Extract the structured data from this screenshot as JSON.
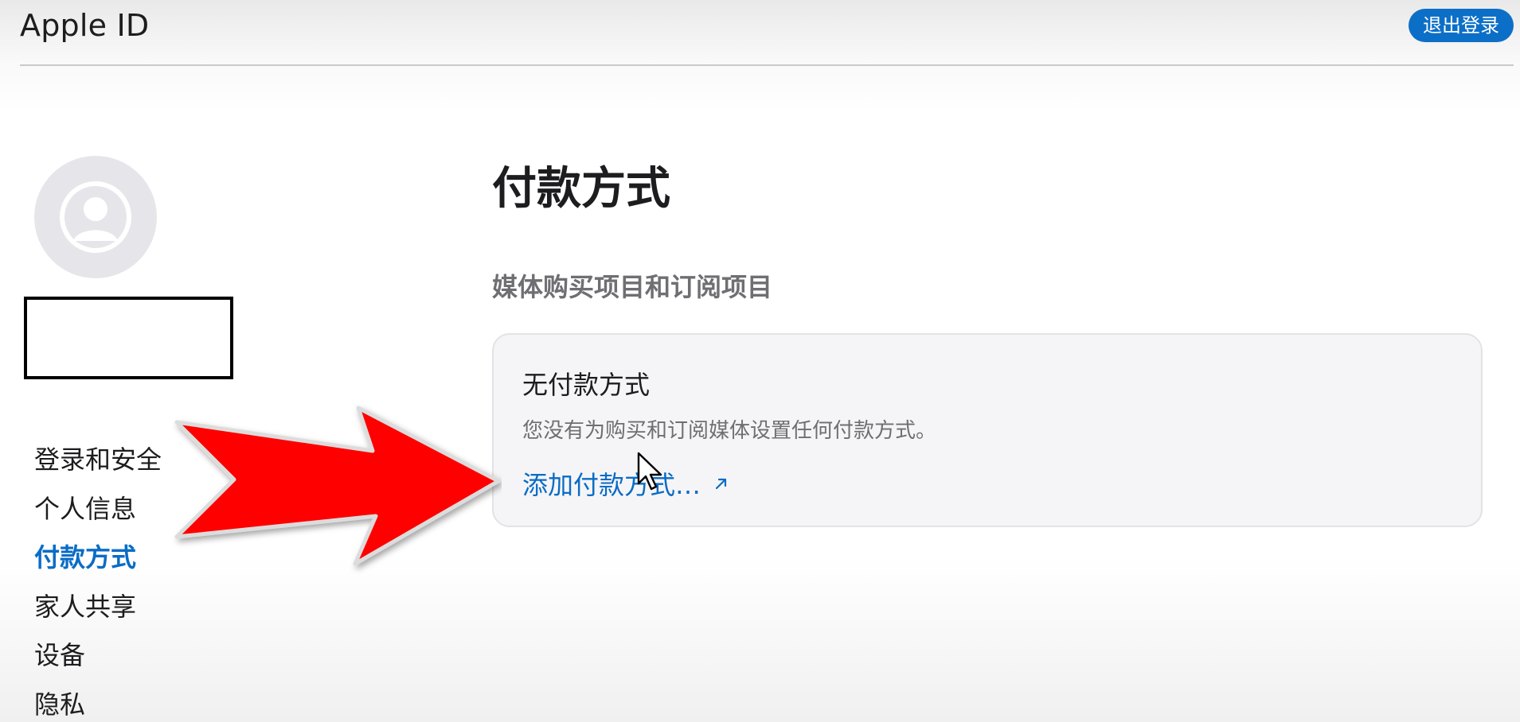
{
  "header": {
    "title": "Apple ID",
    "signout_label": "退出登录"
  },
  "sidebar": {
    "items": [
      {
        "label": "登录和安全",
        "active": false
      },
      {
        "label": "个人信息",
        "active": false
      },
      {
        "label": "付款方式",
        "active": true
      },
      {
        "label": "家人共享",
        "active": false
      },
      {
        "label": "设备",
        "active": false
      },
      {
        "label": "隐私",
        "active": false
      }
    ]
  },
  "main": {
    "title": "付款方式",
    "section_heading": "媒体购买项目和订阅项目",
    "card": {
      "title": "无付款方式",
      "description": "您没有为购买和订阅媒体设置任何付款方式。",
      "link_label": "添加付款方式…"
    }
  },
  "colors": {
    "accent": "#0a6cc5",
    "signout_bg": "#0c6fc7",
    "arrow_red": "#ff0000"
  },
  "icons": {
    "avatar": "person-circle-icon",
    "link": "external-link-arrow-icon",
    "overlay": "red-pointer-arrow",
    "cursor": "mouse-cursor-icon"
  }
}
